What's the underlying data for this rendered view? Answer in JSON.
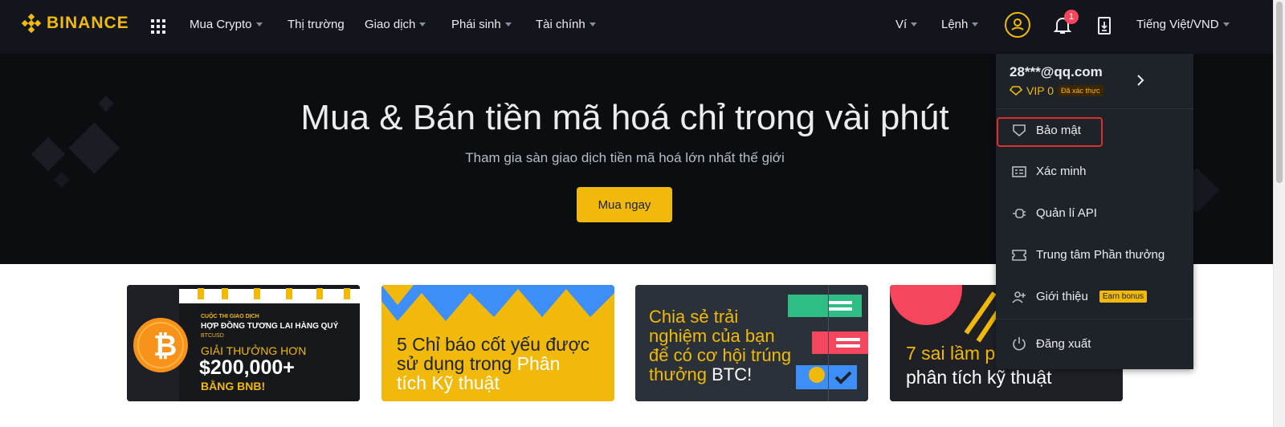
{
  "nav": {
    "logo": "BINANCE",
    "menu": [
      {
        "label": "Mua Crypto",
        "dropdown": true
      },
      {
        "label": "Thị trường",
        "dropdown": false
      },
      {
        "label": "Giao dịch",
        "dropdown": true
      },
      {
        "label": "Phái sinh",
        "dropdown": true
      },
      {
        "label": "Tài chính",
        "dropdown": true
      }
    ],
    "right": {
      "wallet": "Ví",
      "orders": "Lệnh",
      "notification_count": "1",
      "language": "Tiếng Việt/VND"
    }
  },
  "hero": {
    "title": "Mua & Bán tiền mã hoá chỉ trong vài phút",
    "subtitle": "Tham gia sàn giao dịch tiền mã hoá lớn nhất thế giới",
    "button": "Mua ngay"
  },
  "banners": [
    {
      "line1": "CUỘC THI GIAO DỊCH",
      "line2": "HỢP ĐỒNG TƯƠNG LAI HÀNG QUÝ",
      "line3": "BTCUSD",
      "line4": "GIẢI THƯỞNG HƠN",
      "line5": "$200,000+",
      "line6": "BẰNG BNB!"
    },
    {
      "line1": "5 Chỉ báo cốt yếu được",
      "line2": "sử dụng trong",
      "line2b": "Phân",
      "line3": "tích Kỹ thuật"
    },
    {
      "line1": "Chia sẻ trải",
      "line2": "nghiệm của bạn",
      "line3": "để có cơ hội trúng",
      "line4a": "thưởng",
      "line4b": "BTC!"
    },
    {
      "line1": "7 sai lầm p",
      "line2": "phân tích kỹ thuật"
    }
  ],
  "dropdown": {
    "email": "28***@qq.com",
    "vip": "VIP 0",
    "verified": "Đã xác thực",
    "items": [
      {
        "label": "Bảo mật",
        "icon": "shield-icon"
      },
      {
        "label": "Xác minh",
        "icon": "id-card-icon"
      },
      {
        "label": "Quản lí API",
        "icon": "api-key-icon"
      },
      {
        "label": "Trung tâm Phần thưởng",
        "icon": "ticket-icon"
      },
      {
        "label": "Giới thiệu",
        "icon": "add-user-icon",
        "badge": "Earn bonus"
      },
      {
        "label": "Đăng xuất",
        "icon": "power-icon"
      }
    ]
  },
  "colors": {
    "brand": "#f0b90b",
    "nav_bg": "#12161c",
    "dropdown_bg": "#1e2329",
    "highlight": "#d9302b"
  }
}
